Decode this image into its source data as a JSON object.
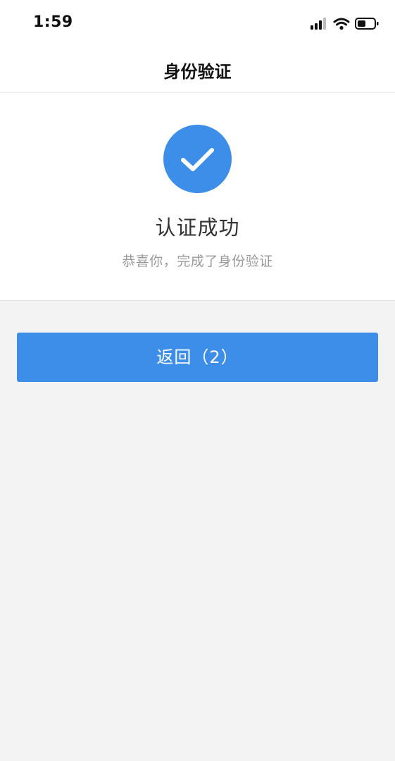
{
  "status_bar": {
    "time": "1:59",
    "icons": [
      "signal-icon",
      "wifi-icon",
      "battery-icon"
    ]
  },
  "header": {
    "title": "身份验证"
  },
  "result": {
    "icon": "checkmark-icon",
    "title": "认证成功",
    "subtitle": "恭喜你，完成了身份验证"
  },
  "actions": {
    "back_label": "返回（2）"
  },
  "colors": {
    "accent": "#3d8ee9",
    "background": "#f3f3f3",
    "panel": "#ffffff",
    "subtitle_text": "#9a9a9a"
  }
}
